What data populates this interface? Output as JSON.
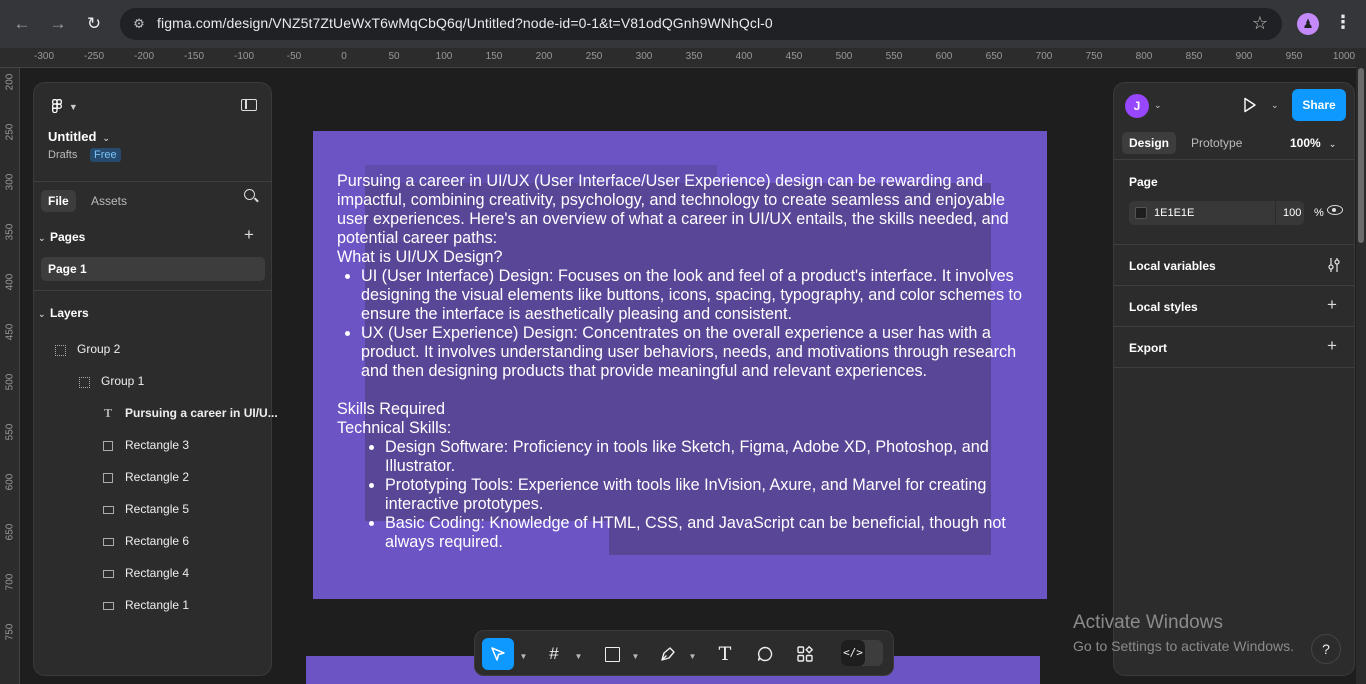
{
  "browser": {
    "url": "figma.com/design/VNZ5t7ZtUeWxT6wMqCbQ6q/Untitled?node-id=0-1&t=V81odQGnh9WNhQcl-0",
    "profile_initial": "♟"
  },
  "ruler": {
    "top": [
      "-300",
      "-250",
      "-200",
      "-150",
      "-100",
      "-50",
      "0",
      "50",
      "100",
      "150",
      "200",
      "250",
      "300",
      "350",
      "400",
      "450",
      "500",
      "550",
      "600",
      "650",
      "700",
      "750",
      "800",
      "850",
      "900",
      "950",
      "1000"
    ],
    "left": [
      "200",
      "250",
      "300",
      "350",
      "400",
      "450",
      "500",
      "550",
      "600",
      "650",
      "700",
      "750"
    ]
  },
  "file": {
    "title": "Untitled",
    "location": "Drafts",
    "plan_badge": "Free"
  },
  "left_tabs": {
    "file": "File",
    "assets": "Assets"
  },
  "pages": {
    "heading": "Pages",
    "items": [
      "Page 1"
    ]
  },
  "layers": {
    "heading": "Layers",
    "items": [
      {
        "label": "Group 2",
        "type": "group",
        "indent": 0
      },
      {
        "label": "Group 1",
        "type": "group",
        "indent": 1
      },
      {
        "label": "Pursuing a career in UI/U...",
        "type": "text",
        "indent": 2
      },
      {
        "label": "Rectangle 3",
        "type": "rect",
        "indent": 2
      },
      {
        "label": "Rectangle 2",
        "type": "rect",
        "indent": 2
      },
      {
        "label": "Rectangle 5",
        "type": "rect-wide",
        "indent": 2
      },
      {
        "label": "Rectangle 6",
        "type": "rect-wide",
        "indent": 2
      },
      {
        "label": "Rectangle 4",
        "type": "rect-wide",
        "indent": 2
      },
      {
        "label": "Rectangle 1",
        "type": "rect-wide",
        "indent": 2
      }
    ]
  },
  "right": {
    "avatar": "J",
    "share": "Share",
    "tabs": {
      "design": "Design",
      "prototype": "Prototype"
    },
    "zoom": "100%",
    "page_heading": "Page",
    "bg_hex": "1E1E1E",
    "bg_opacity": "100",
    "bg_pct": "%",
    "sections": [
      "Local variables",
      "Local styles",
      "Export"
    ]
  },
  "artboard_text": {
    "intro": "Pursuing a career in UI/UX (User Interface/User Experience) design can be rewarding and impactful, combining creativity, psychology, and technology to create seamless and enjoyable user experiences. Here's an overview of what a career in UI/UX entails, the skills needed, and potential career paths:",
    "q1": "What is UI/UX Design?",
    "bullets1": [
      "UI (User Interface) Design: Focuses on the look and feel of a product's interface. It involves designing the visual elements like buttons, icons, spacing, typography, and color schemes to ensure the interface is aesthetically pleasing and consistent.",
      "UX (User Experience) Design: Concentrates on the overall experience a user has with a product. It involves understanding user behaviors, needs, and motivations through research and then designing products that provide meaningful and relevant experiences."
    ],
    "skills": "Skills Required",
    "tech": "Technical Skills:",
    "bullets2": [
      "Design Software: Proficiency in tools like Sketch, Figma, Adobe XD, Photoshop, and Illustrator.",
      "Prototyping Tools: Experience with tools like InVision, Axure, and Marvel for creating interactive prototypes.",
      "Basic Coding: Knowledge of HTML, CSS, and JavaScript can be beneficial, though not always required."
    ]
  },
  "watermark": {
    "line1": "Activate Windows",
    "line2": "Go to Settings to activate Windows."
  },
  "help": "?",
  "colors": {
    "accent": "#0d99ff",
    "artboard": "#6c54c5",
    "canvas": "#1e1e1e"
  }
}
